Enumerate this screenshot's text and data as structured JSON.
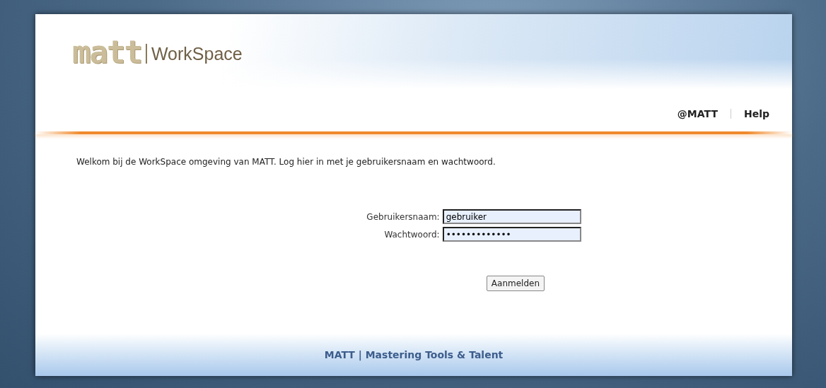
{
  "header": {
    "logo_text": "matt",
    "product": "WorkSpace",
    "links": [
      {
        "label": "@MATT"
      },
      {
        "label": "Help"
      }
    ]
  },
  "welcome": "Welkom bij de WorkSpace omgeving van MATT. Log hier in met je gebruikersnaam en wachtwoord.",
  "form": {
    "fields": [
      {
        "label": "Gebruikersnaam:",
        "value": "gebruiker"
      },
      {
        "label": "Wachtwoord:",
        "value": "•••••••••••••"
      }
    ],
    "submit": "Aanmelden"
  },
  "footer": "MATT | Mastering Tools & Talent"
}
